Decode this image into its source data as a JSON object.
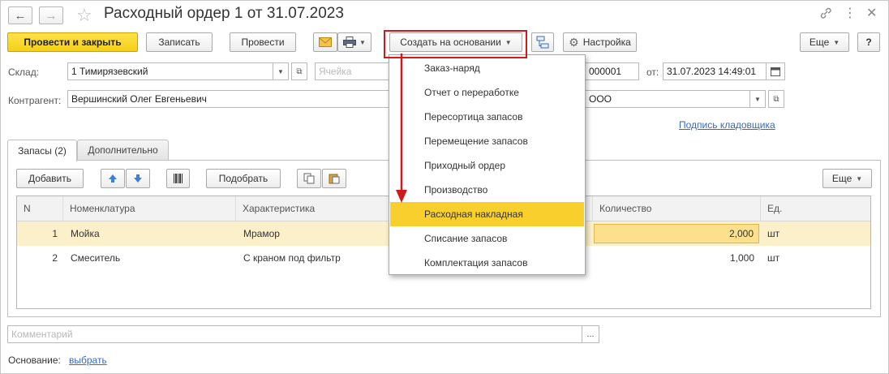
{
  "window": {
    "title": "Расходный ордер 1 от 31.07.2023"
  },
  "toolbar": {
    "post_close_label": "Провести и закрыть",
    "save_label": "Записать",
    "post_label": "Провести",
    "create_based_label": "Создать на основании",
    "settings_label": "Настройка",
    "more_label": "Еще",
    "help_label": "?"
  },
  "header": {
    "warehouse_label": "Склад:",
    "warehouse_value": "1 Тимирязевский",
    "cell_placeholder": "Ячейка",
    "number_value": "000001",
    "date_label": "от:",
    "date_value": "31.07.2023 14:49:01",
    "counterparty_label": "Контрагент:",
    "counterparty_value": "Вершинский Олег Евгеньевич",
    "org_value": "ООО",
    "signature_link": "Подпись кладовщика"
  },
  "tabs": [
    {
      "label": "Запасы (2)",
      "active": true
    },
    {
      "label": "Дополнительно",
      "active": false
    }
  ],
  "table_toolbar": {
    "add_label": "Добавить",
    "pick_label": "Подобрать",
    "more_label": "Еще"
  },
  "table": {
    "columns": [
      "N",
      "Номенклатура",
      "Характеристика",
      "Количество",
      "Ед."
    ],
    "rows": [
      {
        "n": "1",
        "item": "Мойка",
        "characteristic": "Мрамор",
        "qty": "2,000",
        "unit": "шт",
        "selected": true
      },
      {
        "n": "2",
        "item": "Смеситель",
        "characteristic": "С краном под фильтр",
        "qty": "1,000",
        "unit": "шт",
        "selected": false
      }
    ]
  },
  "dropdown_menu": {
    "items": [
      {
        "label": "Заказ-наряд"
      },
      {
        "label": "Отчет о переработке"
      },
      {
        "label": "Пересортица запасов"
      },
      {
        "label": "Перемещение запасов"
      },
      {
        "label": "Приходный ордер"
      },
      {
        "label": "Производство"
      },
      {
        "label": "Расходная накладная",
        "highlighted": true
      },
      {
        "label": "Списание запасов"
      },
      {
        "label": "Комплектация запасов"
      }
    ]
  },
  "footer": {
    "comment_placeholder": "Комментарий",
    "basis_label": "Основание:",
    "basis_link": "выбрать"
  },
  "colors": {
    "primary_button": "#f5cf16",
    "menu_highlight": "#f8cf2c",
    "annotation_red": "#d01a1a",
    "link": "#3a6ab5",
    "selected_row": "#fbf0c9"
  }
}
